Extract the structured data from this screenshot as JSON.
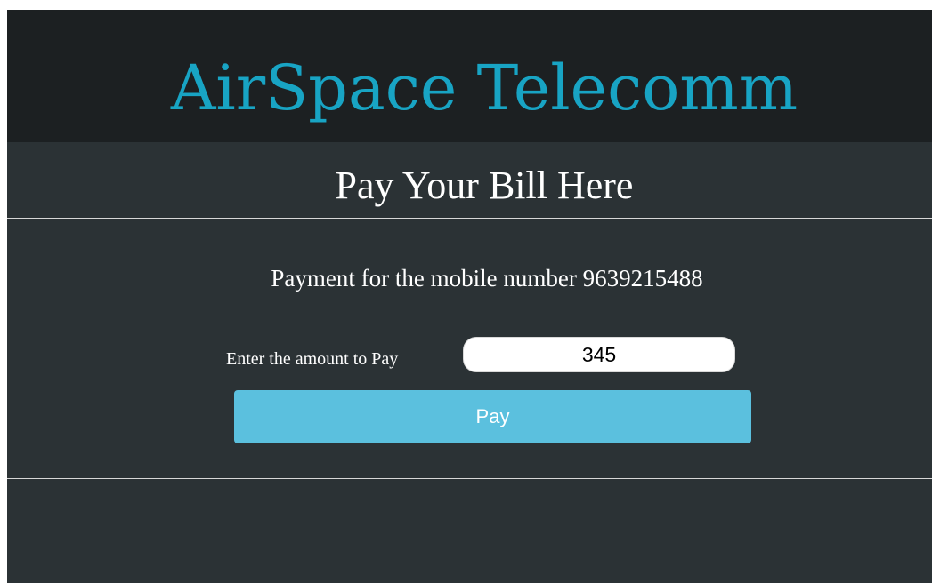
{
  "header": {
    "brand": "AirSpace Telecomm"
  },
  "main": {
    "subtitle": "Pay Your Bill Here",
    "payment_text": "Payment for the mobile number 9639215488",
    "amount_label": "Enter the amount to Pay",
    "amount_value": "345",
    "pay_button_label": "Pay"
  },
  "colors": {
    "page_background": "#2b3235",
    "header_background": "#1c2022",
    "brand": "#18a4c4",
    "button": "#5bc0de",
    "text": "#ffffff"
  }
}
